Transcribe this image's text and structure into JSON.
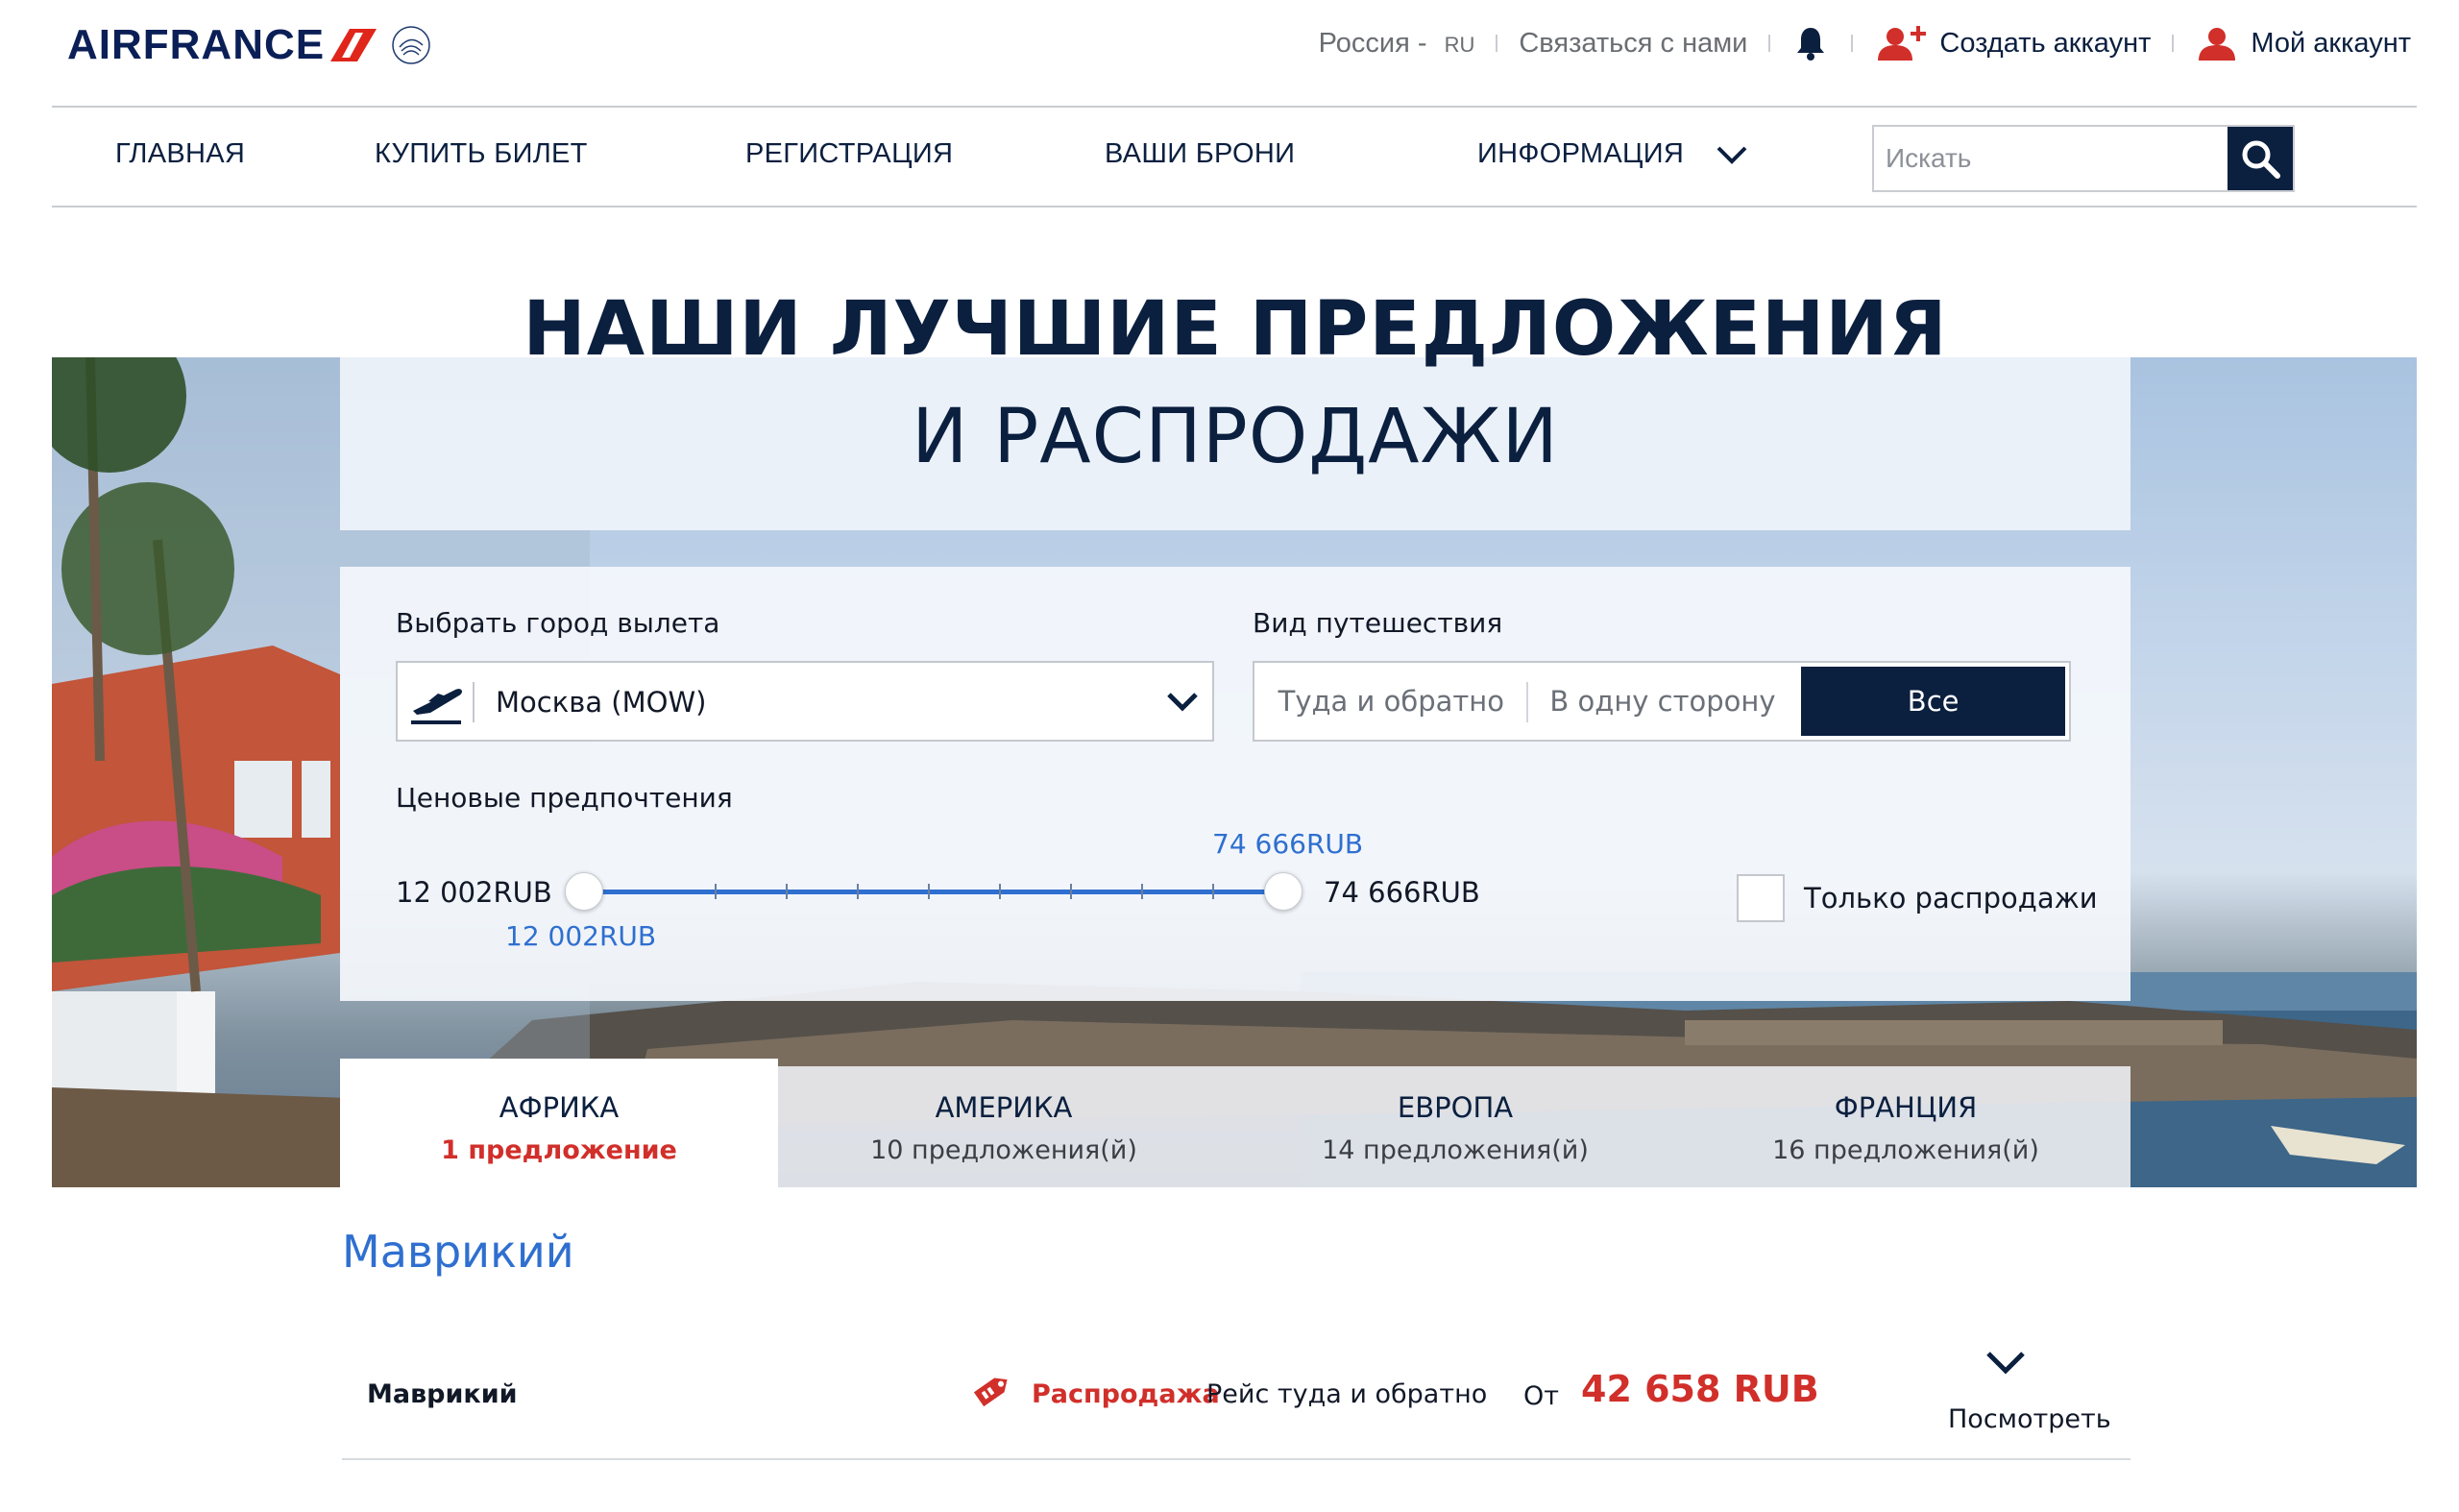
{
  "header": {
    "brand": "AIRFRANCE",
    "region": "Россия",
    "region_dash": "-",
    "lang_code": "RU",
    "contact": "Связаться с нами",
    "create_account": "Создать аккаунт",
    "my_account": "Мой аккаунт"
  },
  "nav": {
    "items": [
      "ГЛАВНАЯ",
      "КУПИТЬ БИЛЕТ",
      "РЕГИСТРАЦИЯ",
      "ВАШИ БРОНИ",
      "ИНФОРМАЦИЯ"
    ],
    "search_placeholder": "Искать"
  },
  "hero": {
    "title_line1": "НАШИ ЛУЧШИЕ ПРЕДЛОЖЕНИЯ",
    "title_line2": "И РАСПРОДАЖИ"
  },
  "filters": {
    "city_label": "Выбрать город вылета",
    "city_value": "Москва (MOW)",
    "trip_label": "Вид путешествия",
    "trip_options": [
      "Туда и обратно",
      "В одну сторону",
      "Все"
    ],
    "trip_selected": "Все",
    "price_label": "Ценовые предпочтения",
    "price_min": "12 002RUB",
    "price_max": "74 666RUB",
    "price_min_tip": "12 002RUB",
    "price_max_tip": "74 666RUB",
    "sale_only_label": "Только распродажи",
    "sale_only_checked": false
  },
  "tabs": [
    {
      "name": "АФРИКА",
      "count": "1 предложение",
      "active": true
    },
    {
      "name": "АМЕРИКА",
      "count": "10 предложения(й)",
      "active": false
    },
    {
      "name": "ЕВРОПА",
      "count": "14 предложения(й)",
      "active": false
    },
    {
      "name": "ФРАНЦИЯ",
      "count": "16 предложения(й)",
      "active": false
    }
  ],
  "results": {
    "region_title": "Маврикий",
    "offers": [
      {
        "destination": "Маврикий",
        "badge": "Распродажа",
        "trip_type": "Рейс туда и обратно",
        "from_label": "От",
        "price": "42 658 RUB",
        "view_label": "Посмотреть"
      }
    ]
  },
  "colors": {
    "navy": "#0b1f3f",
    "accent_red": "#d12f2a",
    "link_blue": "#2f6fd0"
  }
}
